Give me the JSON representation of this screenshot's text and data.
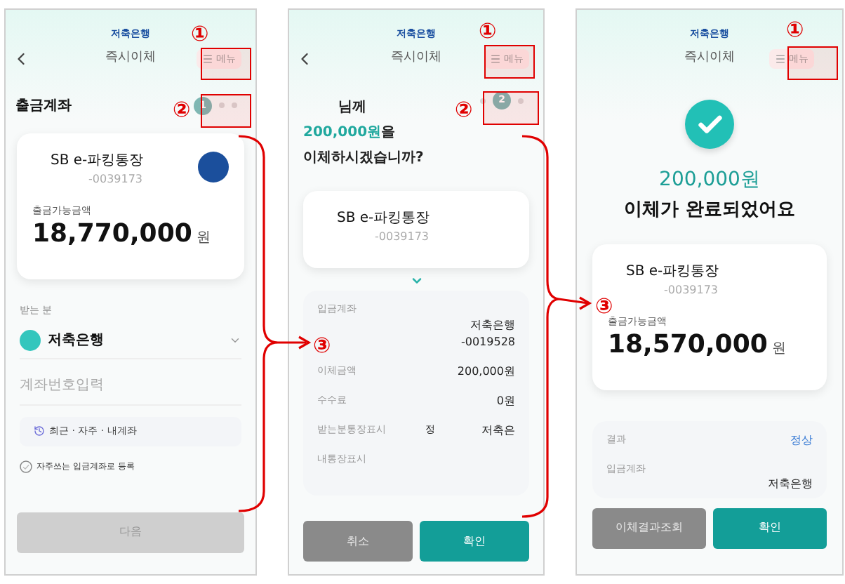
{
  "screens": [
    {
      "kind": "account",
      "bank": "저축은행",
      "title": "즉시이체",
      "back": true,
      "menu": "메뉴",
      "markers": {
        "menu": "①",
        "steps": "②"
      },
      "section": "출금계좌",
      "steps": [
        {
          "label": "1",
          "selected": true
        },
        {
          "selected": false
        },
        {
          "selected": false
        }
      ],
      "card": {
        "name": "SB e-파킹통장",
        "number": "-0039173",
        "balance_label": "출금가능금액",
        "balance": "18,770,000",
        "unit": "원"
      },
      "recipient_label": "받는 분",
      "recipient_bank": "저축은행",
      "account_placeholder": "계좌번호입력",
      "shortcuts": "최근 · 자주 · 내계좌",
      "favorite": {
        "label": "자주쓰는 입금계좌로 등록",
        "checked": false
      },
      "buttons": [
        {
          "label": "다음",
          "kind": "disabled"
        }
      ]
    },
    {
      "kind": "confirm",
      "bank": "저축은행",
      "title": "즉시이체",
      "back": true,
      "menu": "메뉴",
      "markers": {
        "menu": "①",
        "steps": "②",
        "details": "③"
      },
      "steps": [
        {
          "selected": false
        },
        {
          "label": "2",
          "selected": true
        },
        {
          "selected": false
        }
      ],
      "recipient_suffix": "님께",
      "amount": "200,000원",
      "amount_suffix": "을",
      "question": "이체하시겠습니까?",
      "card": {
        "name": "SB e-파킹통장",
        "number": "-0039173"
      },
      "details": [
        {
          "kind": "account",
          "label": "입금계좌",
          "values": [
            "저축은행",
            "-0019528"
          ]
        },
        {
          "kind": "plain",
          "label": "이체금액",
          "value": "200,000원"
        },
        {
          "kind": "plain",
          "label": "수수료",
          "value": "0원"
        },
        {
          "kind": "plain",
          "label": "받는분통장표시",
          "middle": "정",
          "value": "저축은"
        },
        {
          "kind": "plain",
          "label": "내통장표시"
        }
      ],
      "buttons": [
        {
          "label": "취소",
          "kind": "secondary"
        },
        {
          "label": "확인",
          "kind": "primary"
        }
      ]
    },
    {
      "kind": "done",
      "bank": "저축은행",
      "title": "즉시이체",
      "back": false,
      "menu": "메뉴",
      "markers": {
        "menu": "①",
        "card": "③"
      },
      "amount": "200,000원",
      "message": "이체가 완료되었어요",
      "card": {
        "name": "SB e-파킹통장",
        "number": "-0039173",
        "balance_label": "출금가능금액",
        "balance": "18,570,000",
        "unit": "원"
      },
      "details": [
        {
          "kind": "status",
          "label": "결과",
          "value": "정상"
        },
        {
          "kind": "account",
          "label": "입금계좌",
          "values": [
            "저축은행"
          ]
        }
      ],
      "buttons": [
        {
          "label": "이체결과조회",
          "kind": "secondary"
        },
        {
          "label": "확인",
          "kind": "primary"
        }
      ]
    }
  ]
}
